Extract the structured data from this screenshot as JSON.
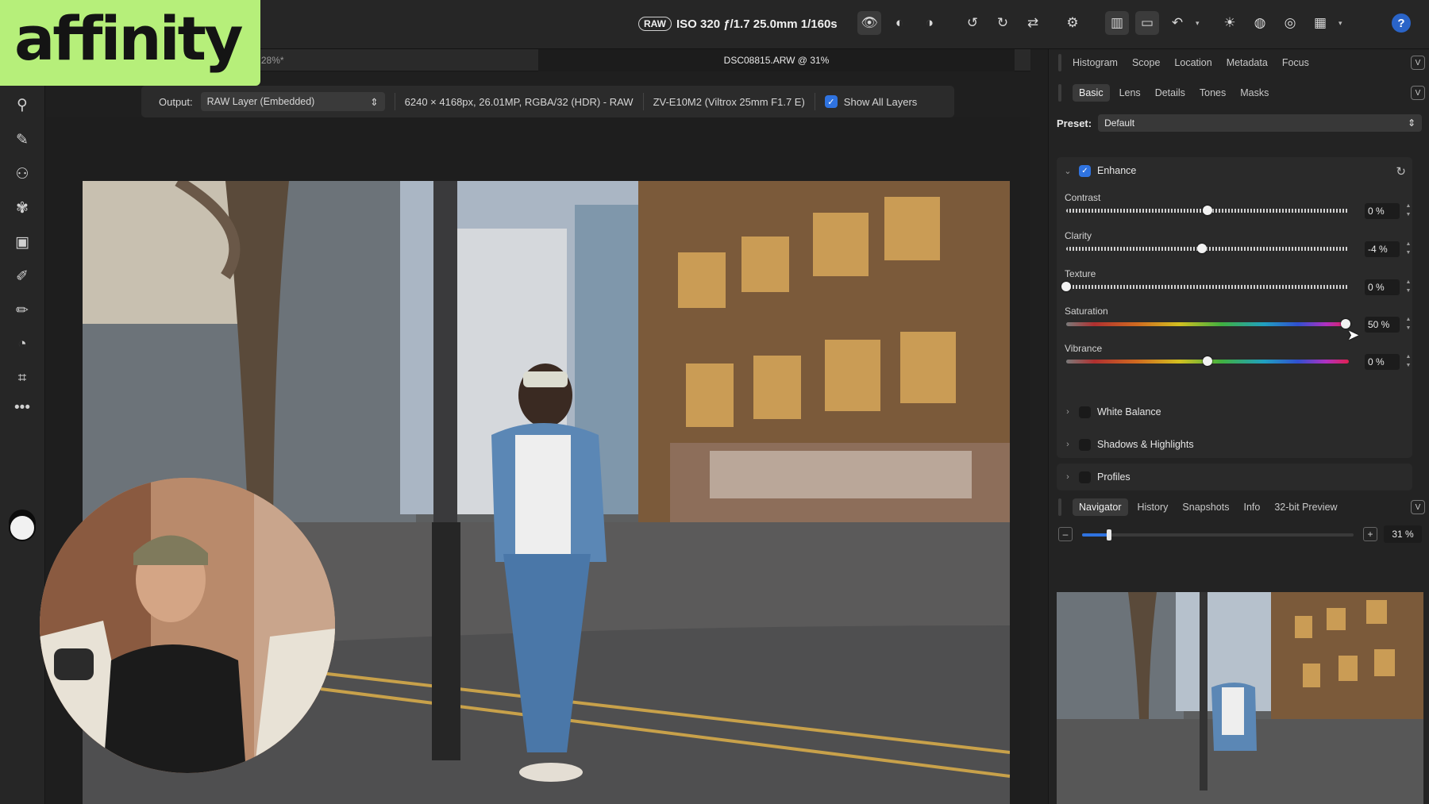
{
  "logo": {
    "text": "affinity"
  },
  "topbar": {
    "raw_badge": "RAW",
    "exif": "ISO 320 ƒ/1.7 25.0mm 1/160s",
    "icons": [
      "eye-icon",
      "split-view-icon",
      "mirror-view-icon",
      "rotate-left-icon",
      "rotate-right-icon",
      "flip-icon",
      "settings-icon",
      "panel-layout-icon",
      "compare-icon",
      "undo-icon",
      "exposure-icon",
      "highlights-icon",
      "clipping-icon",
      "grid-icon",
      "help-icon"
    ],
    "help_label": "?"
  },
  "document_tabs": [
    {
      "label": "C08815 @ 28%*"
    },
    {
      "label": "DSC08815.ARW @ 31%"
    }
  ],
  "context_bar": {
    "output_label": "Output:",
    "output_value": "RAW Layer (Embedded)",
    "image_info": "6240 × 4168px, 26.01MP, RGBA/32 (HDR) - RAW",
    "lens_info": "ZV-E10M2 (Viltrox 25mm F1.7 E)",
    "show_all_layers_label": "Show All Layers",
    "show_all_layers_checked": true
  },
  "left_tools": [
    "view-tool-icon",
    "white-balance-tool-icon",
    "red-eye-tool-icon",
    "inpaint-tool-icon",
    "overlay-tool-icon",
    "brush-tool-icon",
    "erase-tool-icon",
    "clone-tool-icon",
    "crop-tool-icon",
    "more-tools-icon"
  ],
  "top_panel_tabs": {
    "items": [
      "Histogram",
      "Scope",
      "Location",
      "Metadata",
      "Focus"
    ],
    "collapse": "V"
  },
  "develop_tabs": {
    "items": [
      "Basic",
      "Lens",
      "Details",
      "Tones",
      "Masks"
    ],
    "selected": "Basic",
    "collapse": "V"
  },
  "preset": {
    "label": "Preset:",
    "value": "Default"
  },
  "enhance": {
    "title": "Enhance",
    "enabled": true,
    "adjustments": [
      {
        "label": "Contrast",
        "value": "0 %",
        "level": 0.5
      },
      {
        "label": "Clarity",
        "value": "-4 %",
        "level": 0.48
      },
      {
        "label": "Texture",
        "value": "0 %",
        "level": 0.0
      },
      {
        "label": "Saturation",
        "value": "50 %",
        "level": 0.99
      },
      {
        "label": "Vibrance",
        "value": "0 %",
        "level": 0.5
      }
    ]
  },
  "collapsed_sections": [
    "White Balance",
    "Shadows & Highlights",
    "Profiles"
  ],
  "bottom_panel_tabs": {
    "items": [
      "Navigator",
      "History",
      "Snapshots",
      "Info",
      "32-bit Preview"
    ],
    "selected": "Navigator",
    "collapse": "V"
  },
  "navigator": {
    "zoom": "31 %",
    "zoom_level": 0.1,
    "minus": "–",
    "plus": "+"
  }
}
